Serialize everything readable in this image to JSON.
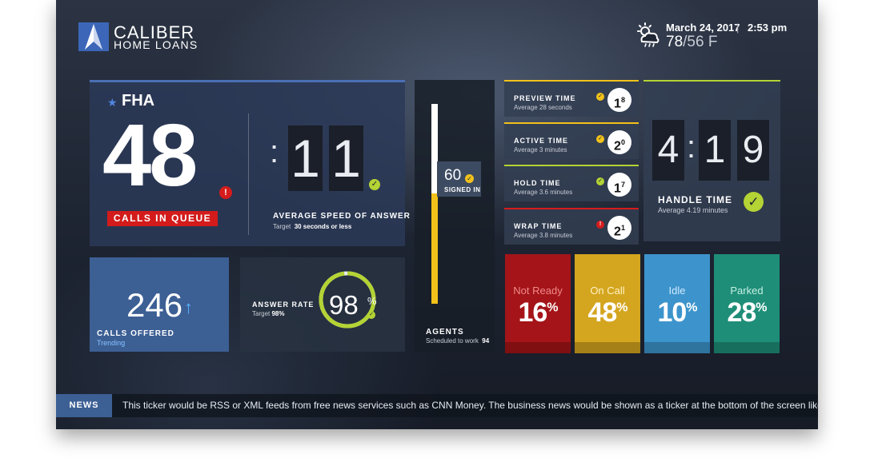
{
  "brand": {
    "line1": "CALIBER",
    "line2": "HOME LOANS"
  },
  "header": {
    "date": "March 24, 2017",
    "separator": "|",
    "time": "2:53 pm",
    "temp_high": "78",
    "temp_low": "/56 F",
    "weather_icon": "cloud-sun-rain-icon"
  },
  "fha": {
    "title": "FHA",
    "queue_count": "48",
    "queue_label": "CALLS IN QUEUE",
    "alert_symbol": "!",
    "asa_colon": ":",
    "asa_digit1": "1",
    "asa_digit2": "1",
    "asa_title": "AVERAGE SPEED OF ANSWER",
    "asa_target_prefix": "Target",
    "asa_target_value": "30 seconds or less"
  },
  "offered": {
    "value": "246",
    "arrow": "↑",
    "title": "CALLS OFFERED",
    "subtitle": "Trending"
  },
  "answer_rate": {
    "title": "ANSWER RATE",
    "target_prefix": "Target",
    "target_value": "98%",
    "value": "98",
    "unit": "%",
    "fraction": 0.98
  },
  "agents": {
    "signed_in": "60",
    "signed_label": "SIGNED IN",
    "title": "AGENTS",
    "sub_prefix": "Scheduled to work",
    "scheduled": "94"
  },
  "metrics": [
    {
      "title": "PREVIEW TIME",
      "sub": "Average 28 seconds",
      "value": "1",
      "decimal": "8"
    },
    {
      "title": "ACTIVE TIME",
      "sub": "Average 3 minutes",
      "value": "2",
      "decimal": "0"
    },
    {
      "title": "HOLD TIME",
      "sub": "Average 3.6 minutes",
      "value": "1",
      "decimal": "7"
    },
    {
      "title": "WRAP TIME",
      "sub": "Average 3.8 minutes",
      "value": "2",
      "decimal": "1"
    }
  ],
  "handle": {
    "d1": "4",
    "colon": ":",
    "d2": "1",
    "d3": "9",
    "title": "HANDLE TIME",
    "sub": "Average 4.19 minutes"
  },
  "status": [
    {
      "label": "Not Ready",
      "value": "16",
      "unit": "%"
    },
    {
      "label": "On Call",
      "value": "48",
      "unit": "%"
    },
    {
      "label": "Idle",
      "value": "10",
      "unit": "%"
    },
    {
      "label": "Parked",
      "value": "28",
      "unit": "%"
    }
  ],
  "news": {
    "label": "NEWS",
    "text": "This ticker would be RSS or XML feeds from free news services such as CNN Money. The business news would be shown as a ticker at the bottom of the screen like this…"
  },
  "colors": {
    "alert_red": "#d61c1c",
    "ok_green": "#b4d334",
    "warn_yellow": "#f2c21b",
    "brand_blue": "#3c5f94"
  }
}
